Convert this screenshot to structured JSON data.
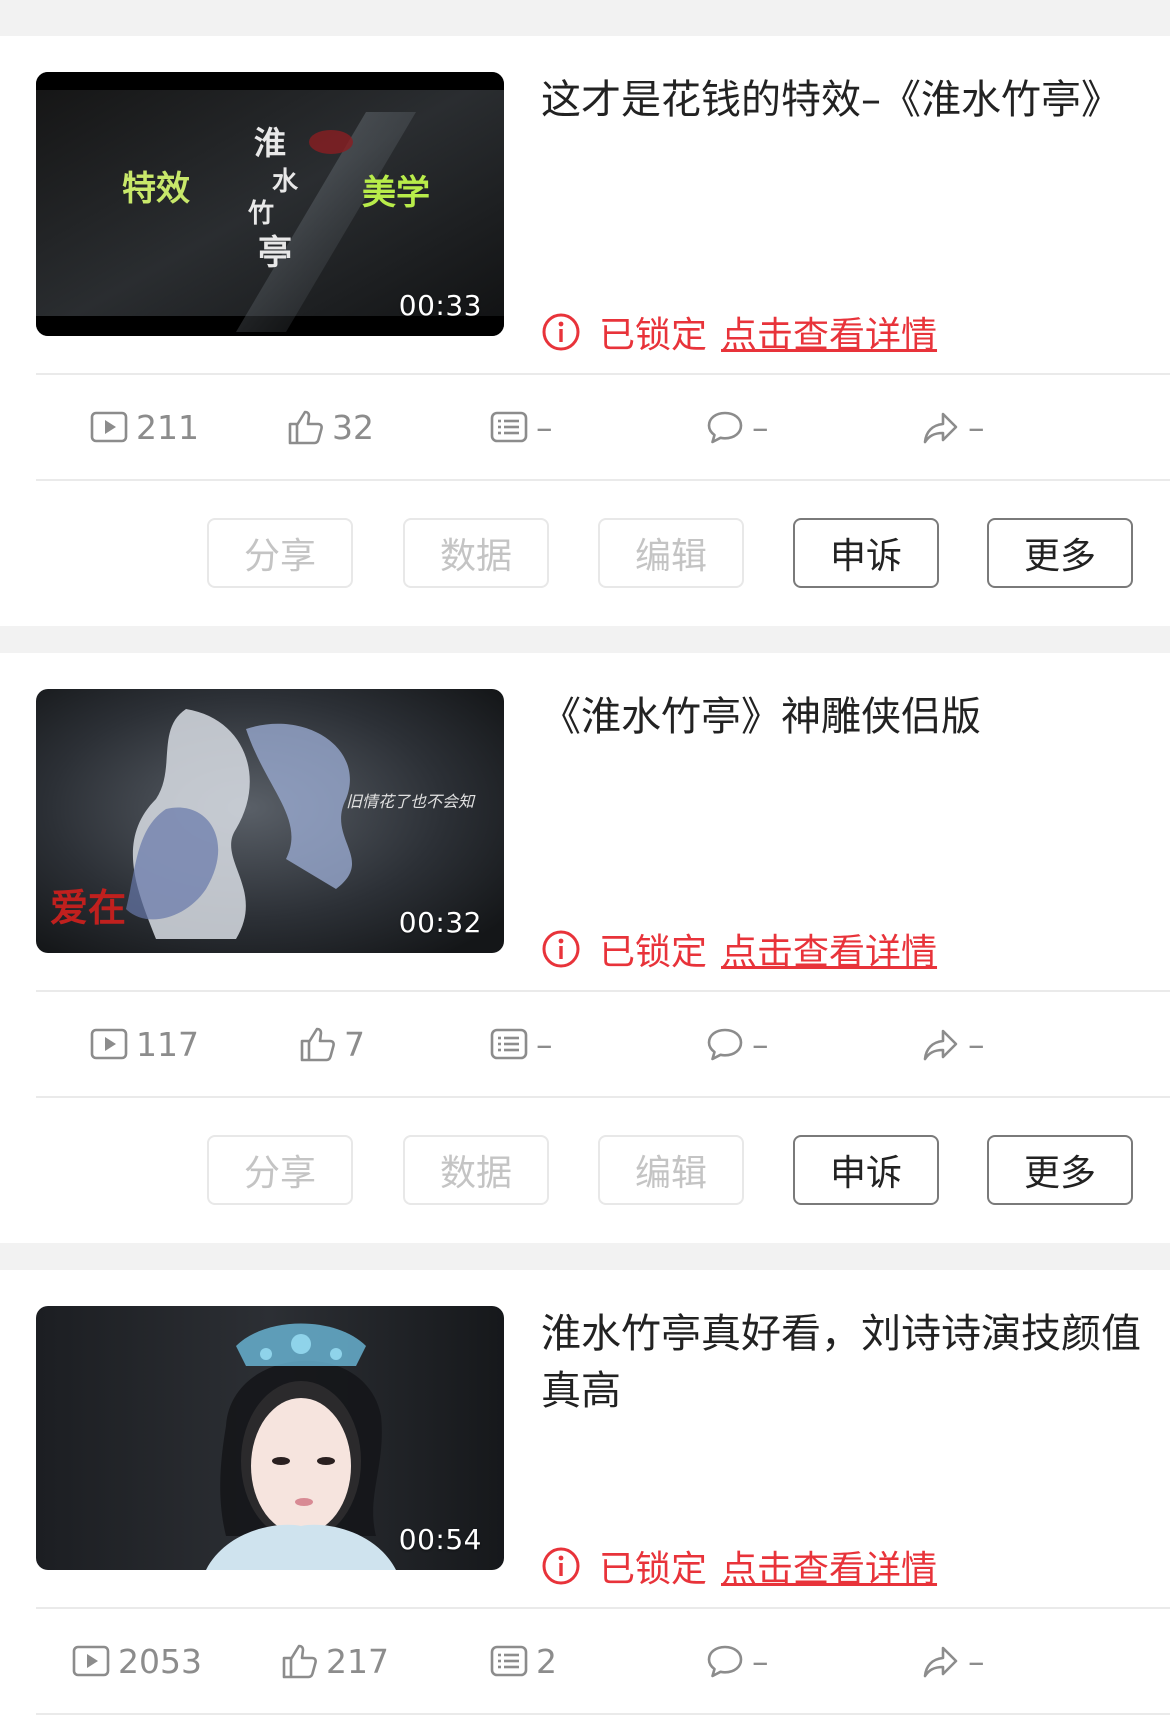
{
  "posts": [
    {
      "title": "这才是花钱的特效–《淮水竹亭》",
      "duration": "00:33",
      "status": "已锁定",
      "detail_link": "点击查看详情",
      "thumb_texts": [
        "特效",
        "美学",
        "淮水竹亭"
      ],
      "stats": {
        "plays": "211",
        "likes": "32",
        "danmaku": "–",
        "comments": "–",
        "shares": "–"
      },
      "actions": [
        "分享",
        "数据",
        "编辑",
        "申诉",
        "更多"
      ]
    },
    {
      "title": "《淮水竹亭》神雕侠侣版",
      "duration": "00:32",
      "status": "已锁定",
      "detail_link": "点击查看详情",
      "thumb_texts": [
        "旧情花了也不会知",
        "爱在"
      ],
      "stats": {
        "plays": "117",
        "likes": "7",
        "danmaku": "–",
        "comments": "–",
        "shares": "–"
      },
      "actions": [
        "分享",
        "数据",
        "编辑",
        "申诉",
        "更多"
      ]
    },
    {
      "title": "淮水竹亭真好看，刘诗诗演技颜值真高",
      "duration": "00:54",
      "status": "已锁定",
      "detail_link": "点击查看详情",
      "stats": {
        "plays": "2053",
        "likes": "217",
        "danmaku": "2",
        "comments": "–",
        "shares": "–"
      }
    }
  ],
  "colors": {
    "locked": "#e8333a",
    "muted": "#8c8c8c",
    "background": "#f2f2f2"
  }
}
